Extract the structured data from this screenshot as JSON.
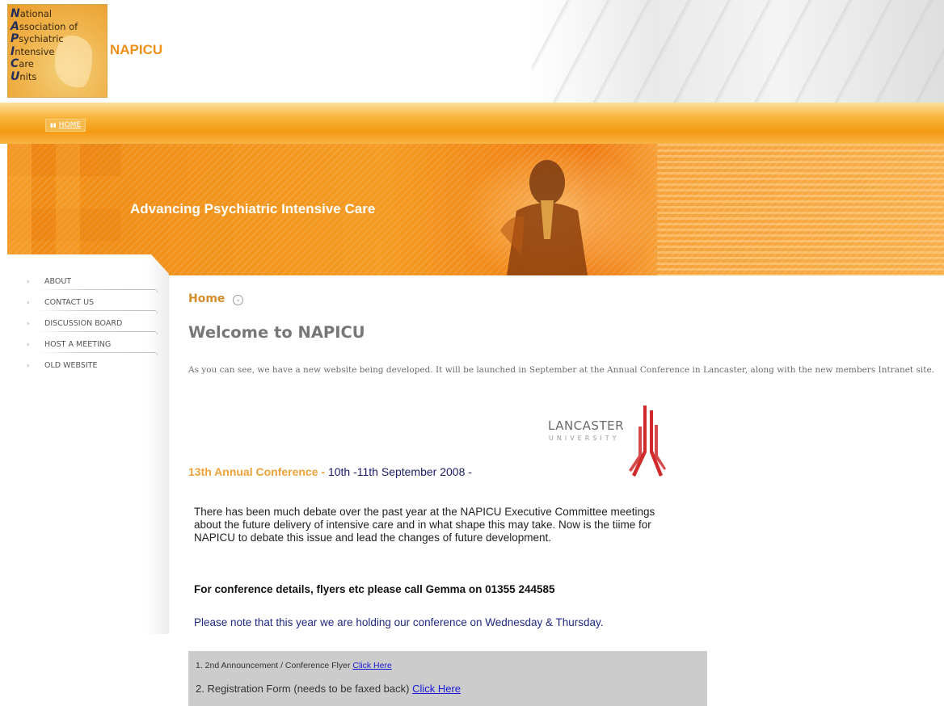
{
  "logo": {
    "lines": [
      {
        "letter": "N",
        "rest": "ational"
      },
      {
        "letter": "A",
        "rest": "ssociation of"
      },
      {
        "letter": "P",
        "rest": "sychiatric"
      },
      {
        "letter": "I",
        "rest": "ntensive"
      },
      {
        "letter": "C",
        "rest": "are"
      },
      {
        "letter": "U",
        "rest": "nits"
      }
    ]
  },
  "header": {
    "brand": "NAPICU"
  },
  "nav": {
    "home_label": "HOME",
    "home_icon": "bars-icon"
  },
  "banner": {
    "tagline": "Advancing Psychiatric Intensive Care"
  },
  "sidebar": {
    "items": [
      {
        "label": "ABOUT"
      },
      {
        "label": "CONTACT US"
      },
      {
        "label": "DISCUSSION BOARD"
      },
      {
        "label": "HOST A MEETING"
      },
      {
        "label": "OLD WEBSITE"
      }
    ]
  },
  "main": {
    "breadcrumb": "Home",
    "title": "Welcome to NAPICU",
    "intro": "As you can see, we have a new website being developed. It will be launched in September at the Annual Conference in Lancaster, along with the new members Intranet site.",
    "lancaster": {
      "word": "LANCASTER",
      "sub": "UNIVERSITY"
    },
    "conference": {
      "title": "13th Annual Conference -",
      "dates": " 10th -11th September 2008 -"
    },
    "body": "There has been much debate over the past year at the NAPICU Executive Committee meetings about the future delivery of intensive care and in what shape this may take. Now is the tiime for NAPICU to debate this issue and lead the changes of future development.",
    "contact": "For conference details, flyers etc please call Gemma on 01355 244585",
    "note": "Please note that this year we are holding our conference on Wednesday & Thursday.",
    "downloads": [
      {
        "text": "1. 2nd Announcement / Conference Flyer ",
        "link": "Click Here"
      },
      {
        "text": "2. Registration Form (needs to be faxed back) ",
        "link": "Click Here"
      }
    ]
  },
  "colors": {
    "accent_orange": "#f49a12",
    "brand_orange": "#f0901a",
    "heading_orange": "#f0a23a",
    "link_blue": "#1a1ad6",
    "lancaster_red": "#d02a2a"
  }
}
